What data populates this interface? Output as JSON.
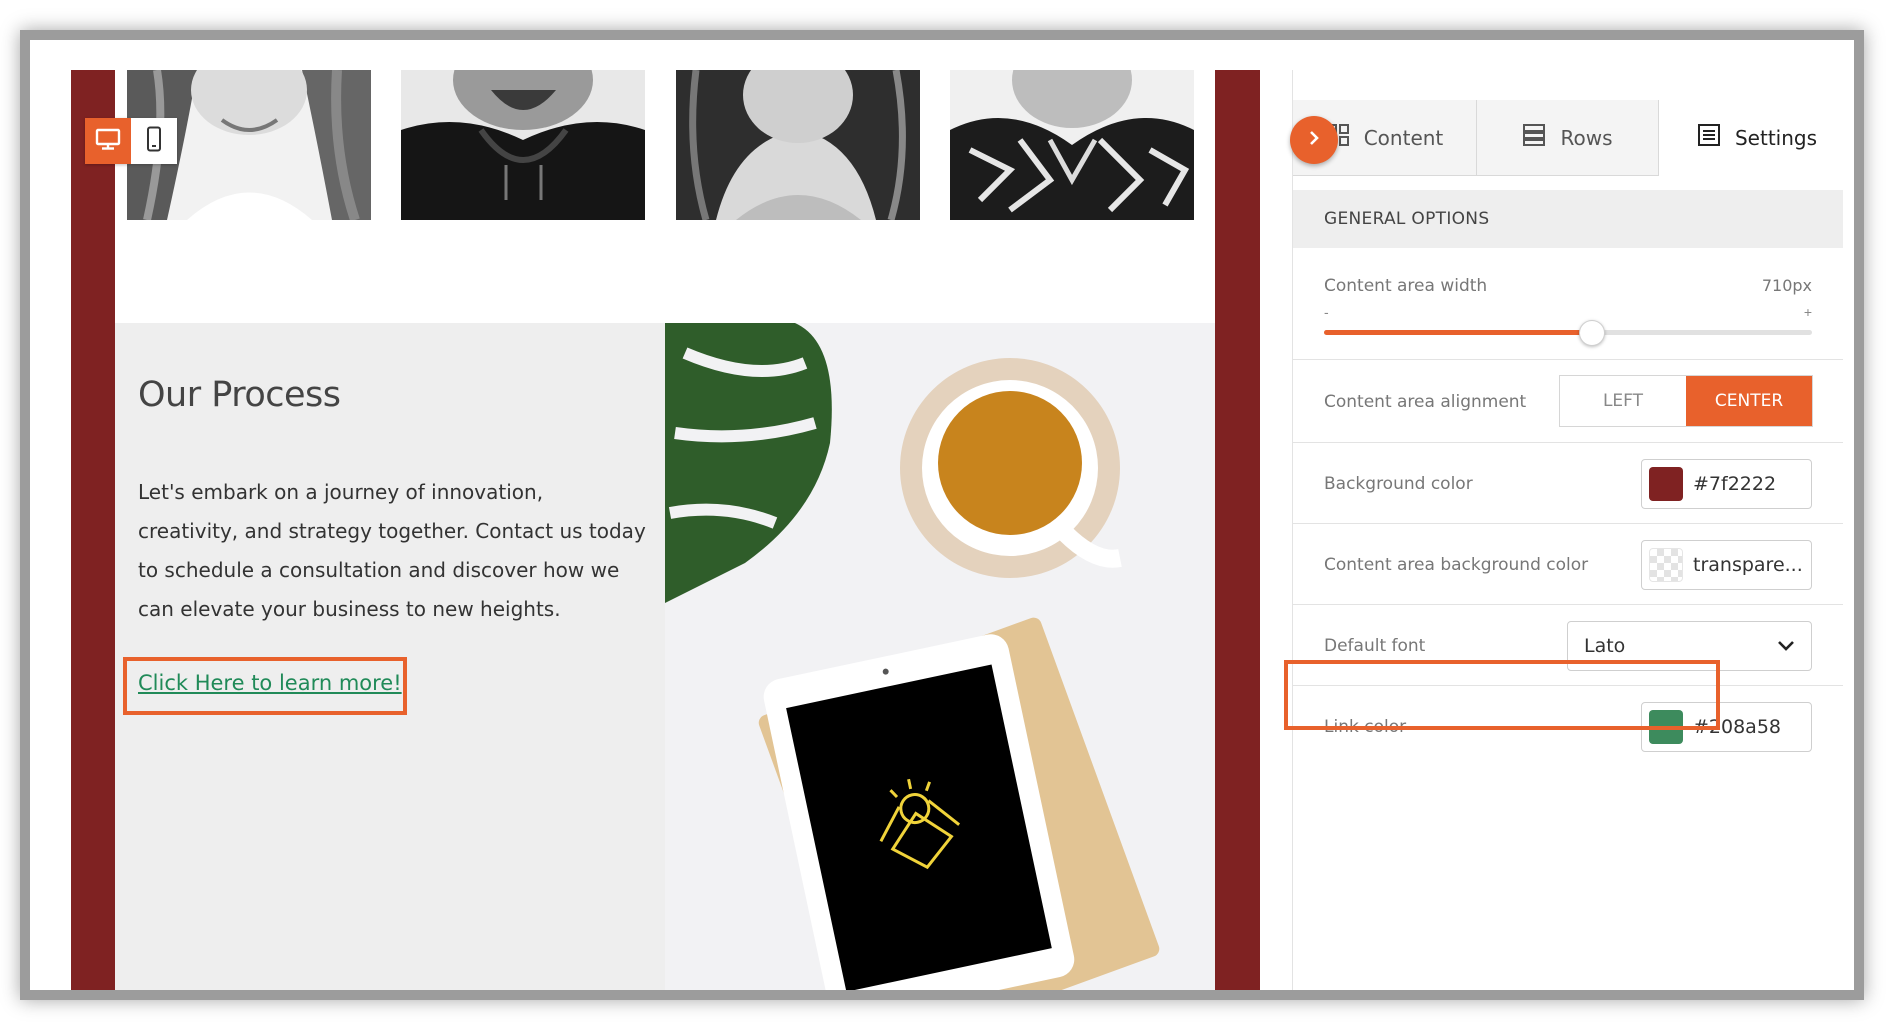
{
  "colors": {
    "accent": "#e8612c",
    "canvas_background": "#7f2222",
    "link": "#208a58"
  },
  "device_toggle": {
    "desktop_icon": "desktop-icon",
    "mobile_icon": "mobile-icon"
  },
  "collapse_icon": "chevron-right-icon",
  "tabs": [
    {
      "label": "Content",
      "icon": "grid-icon"
    },
    {
      "label": "Rows",
      "icon": "rows-icon"
    },
    {
      "label": "Settings",
      "icon": "settings-doc-icon"
    }
  ],
  "general_options": {
    "header": "GENERAL OPTIONS",
    "content_area_width": {
      "label": "Content area width",
      "value": "710px",
      "minus": "-",
      "plus": "+",
      "fraction": 0.55
    },
    "content_area_alignment": {
      "label": "Content area alignment",
      "options": [
        "LEFT",
        "CENTER"
      ],
      "selected": "CENTER"
    },
    "background_color": {
      "label": "Background color",
      "value": "#7f2222",
      "swatch": "#7f2222"
    },
    "content_area_background_color": {
      "label": "Content area background color",
      "value": "transpare..."
    },
    "default_font": {
      "label": "Default font",
      "value": "Lato"
    },
    "link_color": {
      "label": "Link color",
      "value": "#208a58",
      "swatch": "#3d8b5d"
    }
  },
  "email": {
    "process_title": "Our Process",
    "process_body": "Let's embark on a journey of innovation, creativity, and strategy together. Contact us today to schedule a consultation and discover how we can elevate your business to new heights.",
    "link_text": "Click Here to learn more!"
  }
}
